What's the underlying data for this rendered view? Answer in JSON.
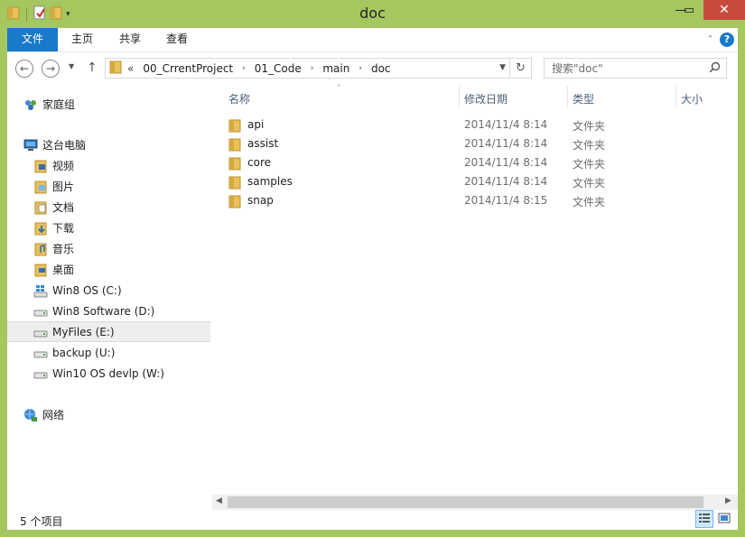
{
  "window": {
    "title": "doc"
  },
  "titlebar": {
    "min_icon": "minimize-icon",
    "max_icon": "maximize-icon",
    "close_icon": "close-icon",
    "close_glyph": "✕",
    "min_glyph": "—",
    "max_glyph": "▭"
  },
  "ribbon": {
    "tabs": [
      {
        "label": "文件",
        "active": true
      },
      {
        "label": "主页"
      },
      {
        "label": "共享"
      },
      {
        "label": "查看"
      }
    ],
    "help": "?"
  },
  "navigation": {
    "back": "←",
    "forward": "→",
    "recent": "▼",
    "up": "↑",
    "address": {
      "overflow": "«",
      "crumbs": [
        "00_CrrentProject",
        "01_Code",
        "main",
        "doc"
      ],
      "separator": "›"
    },
    "refresh": "↻",
    "search_placeholder": "搜索\"doc\""
  },
  "sidebar": {
    "items": [
      {
        "label": "家庭组",
        "icon": "homegroup-icon"
      },
      {
        "label": "这台电脑",
        "icon": "computer-icon"
      },
      {
        "label": "视频",
        "icon": "videos-folder-icon"
      },
      {
        "label": "图片",
        "icon": "pictures-folder-icon"
      },
      {
        "label": "文档",
        "icon": "documents-folder-icon"
      },
      {
        "label": "下载",
        "icon": "downloads-folder-icon"
      },
      {
        "label": "音乐",
        "icon": "music-folder-icon"
      },
      {
        "label": "桌面",
        "icon": "desktop-folder-icon"
      },
      {
        "label": "Win8 OS (C:)",
        "icon": "system-drive-icon"
      },
      {
        "label": "Win8 Software (D:)",
        "icon": "drive-icon"
      },
      {
        "label": "MyFiles (E:)",
        "icon": "drive-icon",
        "selected": true
      },
      {
        "label": "backup (U:)",
        "icon": "drive-icon"
      },
      {
        "label": "Win10 OS devlp (W:)",
        "icon": "drive-icon"
      },
      {
        "label": "网络",
        "icon": "network-icon"
      }
    ]
  },
  "file_list": {
    "columns": [
      "名称",
      "修改日期",
      "类型",
      "大小"
    ],
    "sort_indicator": "˄",
    "rows": [
      {
        "name": "api",
        "date": "2014/11/4 8:14",
        "type": "文件夹"
      },
      {
        "name": "assist",
        "date": "2014/11/4 8:14",
        "type": "文件夹"
      },
      {
        "name": "core",
        "date": "2014/11/4 8:14",
        "type": "文件夹"
      },
      {
        "name": "samples",
        "date": "2014/11/4 8:14",
        "type": "文件夹"
      },
      {
        "name": "snap",
        "date": "2014/11/4 8:15",
        "type": "文件夹"
      }
    ]
  },
  "scrollbar": {
    "left": "◀",
    "right": "▶"
  },
  "status": {
    "item_count": "5 个项目"
  },
  "colors": {
    "frame": "#a5c75f",
    "file_tab": "#1979ca",
    "close": "#c74b3c",
    "selected_row": "#eeeeee"
  }
}
